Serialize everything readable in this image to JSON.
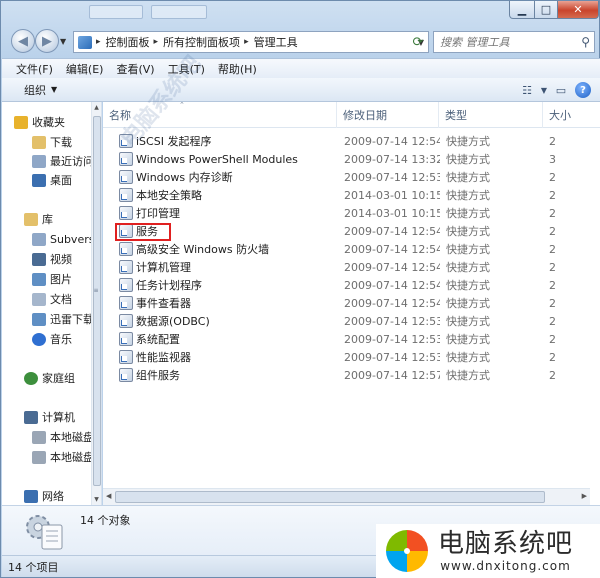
{
  "address": {
    "crumbs": [
      "控制面板",
      "所有控制面板项",
      "管理工具"
    ]
  },
  "search": {
    "placeholder": "搜索 管理工具"
  },
  "menu": [
    "文件(F)",
    "编辑(E)",
    "查看(V)",
    "工具(T)",
    "帮助(H)"
  ],
  "toolbar": {
    "organize": "组织"
  },
  "sidebar": {
    "items": [
      {
        "label": "收藏夹",
        "icon": "star-icon",
        "color": "#e8b22c"
      },
      {
        "label": "下载",
        "icon": "download-folder-icon",
        "color": "#e3c06a"
      },
      {
        "label": "最近访问",
        "icon": "recent-icon",
        "color": "#8fa7c7"
      },
      {
        "label": "桌面",
        "icon": "desktop-icon",
        "color": "#3b6fb0"
      },
      {
        "label": "库",
        "icon": "library-icon",
        "color": "#e3c06a"
      },
      {
        "label": "Subversi",
        "icon": "subversion-icon",
        "color": "#8fa7c7"
      },
      {
        "label": "视频",
        "icon": "video-icon",
        "color": "#4a6b93"
      },
      {
        "label": "图片",
        "icon": "picture-icon",
        "color": "#5f8fc4"
      },
      {
        "label": "文档",
        "icon": "document-icon",
        "color": "#a5b6cc"
      },
      {
        "label": "迅雷下载",
        "icon": "thunder-download-icon",
        "color": "#5f8fc4"
      },
      {
        "label": "音乐",
        "icon": "music-icon",
        "color": "#2f6fd1"
      },
      {
        "label": "家庭组",
        "icon": "homegroup-icon",
        "color": "#3d8f3d"
      },
      {
        "label": "计算机",
        "icon": "computer-icon",
        "color": "#4a6b93"
      },
      {
        "label": "本地磁盘",
        "icon": "local-disk-icon",
        "color": "#9aa6b5"
      },
      {
        "label": "本地磁盘",
        "icon": "local-disk-icon",
        "color": "#9aa6b5"
      },
      {
        "label": "网络",
        "icon": "network-icon",
        "color": "#3b6fb0"
      }
    ]
  },
  "columns": [
    "名称",
    "修改日期",
    "类型",
    "大小"
  ],
  "files": [
    {
      "name": "iSCSI 发起程序",
      "date": "2009-07-14 12:54",
      "type": "快捷方式",
      "size": "2"
    },
    {
      "name": "Windows PowerShell Modules",
      "date": "2009-07-14 13:32",
      "type": "快捷方式",
      "size": "3"
    },
    {
      "name": "Windows 内存诊断",
      "date": "2009-07-14 12:53",
      "type": "快捷方式",
      "size": "2"
    },
    {
      "name": "本地安全策略",
      "date": "2014-03-01 10:15",
      "type": "快捷方式",
      "size": "2"
    },
    {
      "name": "打印管理",
      "date": "2014-03-01 10:15",
      "type": "快捷方式",
      "size": "2"
    },
    {
      "name": "服务",
      "date": "2009-07-14 12:54",
      "type": "快捷方式",
      "size": "2"
    },
    {
      "name": "高级安全 Windows 防火墙",
      "date": "2009-07-14 12:54",
      "type": "快捷方式",
      "size": "2"
    },
    {
      "name": "计算机管理",
      "date": "2009-07-14 12:54",
      "type": "快捷方式",
      "size": "2"
    },
    {
      "name": "任务计划程序",
      "date": "2009-07-14 12:54",
      "type": "快捷方式",
      "size": "2"
    },
    {
      "name": "事件查看器",
      "date": "2009-07-14 12:54",
      "type": "快捷方式",
      "size": "2"
    },
    {
      "name": "数据源(ODBC)",
      "date": "2009-07-14 12:53",
      "type": "快捷方式",
      "size": "2"
    },
    {
      "name": "系统配置",
      "date": "2009-07-14 12:53",
      "type": "快捷方式",
      "size": "2"
    },
    {
      "name": "性能监视器",
      "date": "2009-07-14 12:53",
      "type": "快捷方式",
      "size": "2"
    },
    {
      "name": "组件服务",
      "date": "2009-07-14 12:57",
      "type": "快捷方式",
      "size": "2"
    }
  ],
  "highlighted_item": "服务",
  "details": {
    "count": "14 个对象"
  },
  "status": {
    "text": "14 个项目"
  },
  "watermark": {
    "diagonal": "电脑系统吧",
    "brand_name": "电脑系统吧",
    "brand_url": "www.dnxitong.com"
  },
  "colors": {
    "highlight_border": "#e02020",
    "close_button": "#c9442c",
    "selection": "#3399ff"
  }
}
